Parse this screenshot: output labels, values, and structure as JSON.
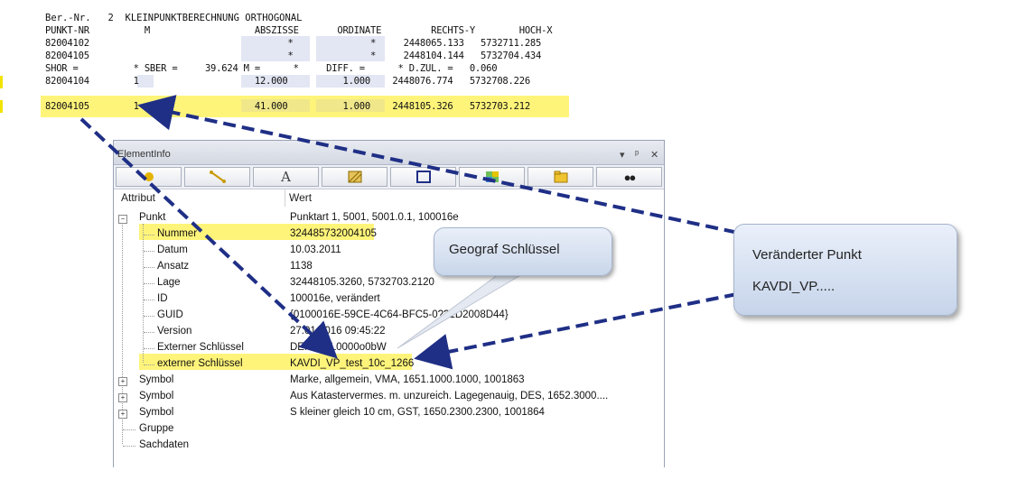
{
  "report": {
    "line1": "Ber.-Nr.   2  KLEINPUNKTBERECHNUNG ORTHOGONAL",
    "header": "PUNKT-NR          M                   ABSZISSE       ORDINATE         RECHTS-Y        HOCH-X",
    "row1": "82004102                                    *              *     2448065.133   5732711.285",
    "row2": "82004105                                    *              *     2448104.144   5732704.434",
    "row3": "SHOR =          * SBER =     39.624 M =      *     DIFF. =      * D.ZUL. =   0.060",
    "row4": "82004104        1                     12.000          1.000    2448076.774   5732708.226",
    "row5": "82004105        1                     41.000          1.000    2448105.326   5732703.212"
  },
  "panel": {
    "title": "ElementInfo",
    "pin_icon": "pin-icon",
    "close_icon": "close-icon",
    "col_attribute": "Attribut",
    "col_value": "Wert",
    "toolbar": [
      "point-icon",
      "line-icon",
      "text-icon",
      "hatch-icon",
      "object-icon",
      "raster-icon",
      "folder-icon",
      "binoculars-icon"
    ]
  },
  "tree": [
    {
      "label": "Punkt",
      "value": "Punktart 1, 5001, 5001.0.1, 100016e",
      "expander": "−"
    },
    {
      "label": "Nummer",
      "value": "32448573200410​5"
    },
    {
      "label": "Datum",
      "value": "10.03.2011"
    },
    {
      "label": "Ansatz",
      "value": "1138"
    },
    {
      "label": "Lage",
      "value": "32448105.3260, 5732703.2120"
    },
    {
      "label": "ID",
      "value": "100016e, verändert"
    },
    {
      "label": "GUID",
      "value": "{0100016E-59CE-4C64-BFC5-0??1D2008D44}"
    },
    {
      "label": "Version",
      "value": "27.01.2016 09:45:22"
    },
    {
      "label": "Externer Schlüssel",
      "value": "DEN??AL0000o0bW"
    },
    {
      "label": "externer Schlüssel",
      "value": "KAVDI_VP_test_10c_1266"
    },
    {
      "label": "Symbol",
      "value": "Marke, allgemein, VMA, 1651.1000.1000, 1001863",
      "expander": "+"
    },
    {
      "label": "Symbol",
      "value": "Aus Katastervermes. m. unzureich. Lagegenauig, DES, 1652.3000....",
      "expander": "+"
    },
    {
      "label": "Symbol",
      "value": "S kleiner gleich 10 cm, GST, 1650.2300.2300, 1001864",
      "expander": "+"
    },
    {
      "label": "Gruppe",
      "value": ""
    },
    {
      "label": "Sachdaten",
      "value": ""
    }
  ],
  "callouts": {
    "geograf": "Geograf Schlüssel",
    "changed_line1": "Veränderter Punkt",
    "changed_line2": "KAVDI_VP....."
  },
  "colors": {
    "highlight": "#fff47a",
    "arrow": "#1f2f86",
    "bubble": "#d7e3f4"
  }
}
